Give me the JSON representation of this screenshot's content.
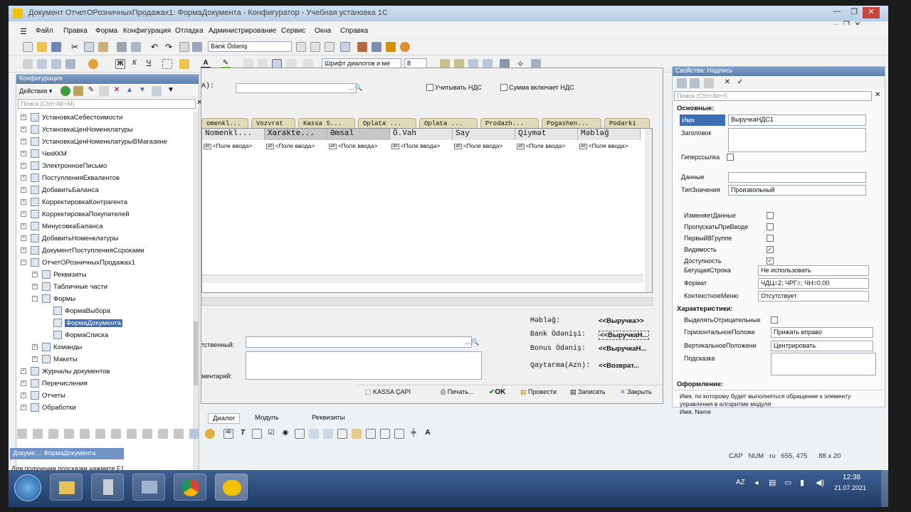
{
  "window": {
    "title": "Документ ОтчетОРозничныхПродажах1: ФормаДокумента - Конфигуратор - Учебная установка 1С"
  },
  "menu": [
    "Файл",
    "Правка",
    "Форма",
    "Конфигурация",
    "Отладка",
    "Администрирование",
    "Сервис",
    "Окна",
    "Справка"
  ],
  "toolbar": {
    "object_combo": "Bank Ödəniş",
    "font_combo": "Шрифт диалогов и ме",
    "font_size": "8"
  },
  "left_panel": {
    "title": "Конфигурация",
    "actions_label": "Действия ▾",
    "search_placeholder": "Поиск (Ctrl+Alt+M)",
    "items": [
      {
        "label": "УстановкаСебестоимости"
      },
      {
        "label": "УстановкаЦенНоменклатуры"
      },
      {
        "label": "УстановкаЦенНоменклатурыВМагазине"
      },
      {
        "label": "ЧекККМ"
      },
      {
        "label": "ЭлектронноеПисьмо"
      },
      {
        "label": "ПоступленияЕквалентов"
      },
      {
        "label": "ДобавитьБаланса"
      },
      {
        "label": "КорректировкаКонтрагента"
      },
      {
        "label": "КорректировкаПокупателей"
      },
      {
        "label": "МинусовкаБаланса"
      },
      {
        "label": "ДобавитьНоменклатуры"
      },
      {
        "label": "ДокументПоступленияСсроками"
      },
      {
        "label": "ОтчетОРозничныхПродажах1"
      },
      {
        "label": "Реквизиты"
      },
      {
        "label": "Табличные части"
      },
      {
        "label": "Формы"
      },
      {
        "label": "ФормаВыбора"
      },
      {
        "label": "ФормаДокумента"
      },
      {
        "label": "ФормаСписка"
      },
      {
        "label": "Команды"
      },
      {
        "label": "Макеты"
      },
      {
        "label": "Журналы документов"
      },
      {
        "label": "Перечисления"
      },
      {
        "label": "Отчеты"
      },
      {
        "label": "Обработки"
      }
    ]
  },
  "form": {
    "field_label_a": "A):",
    "vat_check": "Учитывать НДС",
    "sum_vat_check": "Сумма включает НДС",
    "tabs": [
      "omenkl...",
      "Vozvrat",
      "Kassa S...",
      "Oplata ...",
      "Oplata ...",
      "Prodazh...",
      "Pogashen...",
      "Podarki"
    ],
    "columns": [
      "Nomenkl...",
      "Xarakte...",
      "Əmsal",
      "Ö.Vah",
      "Say",
      "Qiymət",
      "Məbləğ"
    ],
    "cell_placeholder": "<Поле ввода>",
    "responsible_label": "тственный:",
    "comment_label": "ментарий:",
    "totals": [
      {
        "label": "Məbləğ:",
        "value": "<<Выручка>>"
      },
      {
        "label": "Bank Ödənişi:",
        "value": "<<ВыручкаН..."
      },
      {
        "label": "Bonus Ödəniş:",
        "value": "<<ВыручкаН..."
      },
      {
        "label": "Qaytarma(Azn):",
        "value": "<<Возврат..."
      }
    ],
    "buttons": {
      "kassa": "KASSA ÇAPI",
      "print": "Печать...",
      "ok": "OK",
      "post": "Провести",
      "save": "Записать",
      "close": "Закрыть"
    }
  },
  "right_panel": {
    "title": "Свойства: Надпись",
    "search_placeholder": "Поиск (Ctrl+Alt+I)",
    "section_basic": "Основные:",
    "name_label": "Имя",
    "name_value": "ВыручкаНДС1",
    "header_label": "Заголовок",
    "hyperlink_label": "Гиперссылка",
    "data_label": "Данные",
    "type_label": "ТипЗначения",
    "type_value": "Произвольный",
    "checks": [
      {
        "label": "ИзменяетДанные",
        "checked": false
      },
      {
        "label": "ПропускатьПриВводе",
        "checked": false
      },
      {
        "label": "ПервыйВГруппе",
        "checked": false
      },
      {
        "label": "Видимость",
        "checked": true
      },
      {
        "label": "Доступность",
        "checked": true
      }
    ],
    "running_line_label": "БегущаяСтрока",
    "running_line_value": "Не использовать",
    "format_label": "Формат",
    "format_value": "ЧДЦ=2; ЧРГ=; ЧН=0,00",
    "context_menu_label": "КонтекстноеМеню",
    "context_menu_value": "Отсутствует",
    "section_char": "Характеристики:",
    "highlight_neg_label": "ВыделятьОтрицательные",
    "h_pos_label": "ГоризонтальноеПоложе",
    "h_pos_value": "Прижать вправо",
    "v_pos_label": "ВертикальноеПоложени",
    "v_pos_value": "Центрировать",
    "hint_label": "Подсказка",
    "section_design": "Оформление:",
    "description": "Имя, по которому будет выполняться обращение к элементу управления в алгоритме модуля",
    "description2": "Имя, Name"
  },
  "bottom_tabs": [
    "Диалог",
    "Модуль",
    "Реквизиты"
  ],
  "taskbar_doc": {
    "label": "Докуме...: ФормаДокумента"
  },
  "status": {
    "hint": "Для получения подсказки нажмите F1",
    "cap": "CAP",
    "num": "NUM",
    "lang": "ru",
    "coords": "655, 475",
    "size": "88 x 20"
  },
  "tray": {
    "lang": "AZ",
    "time": "12:38",
    "date": "21.07.2021"
  }
}
